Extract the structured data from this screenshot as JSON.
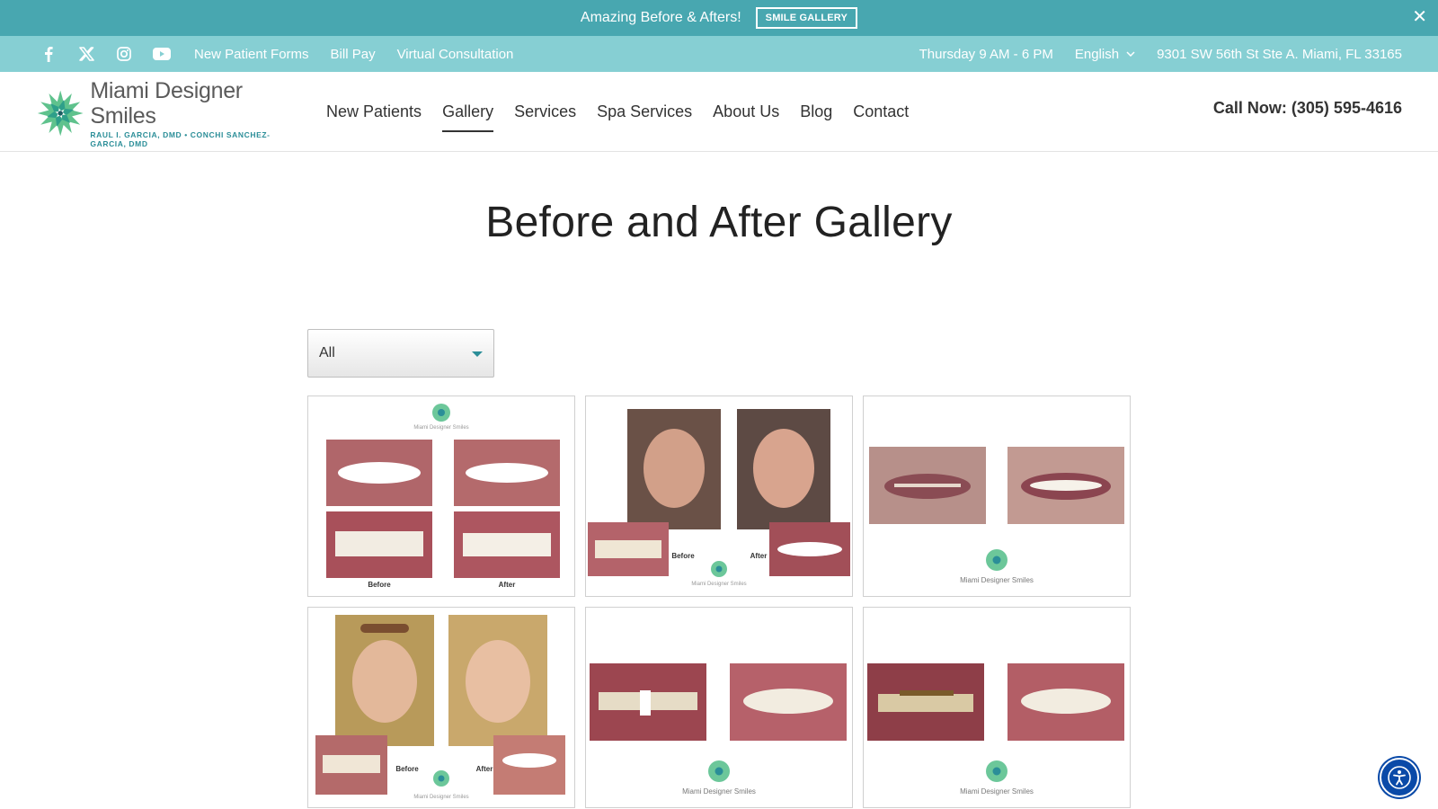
{
  "announcement": {
    "text": "Amazing Before & Afters!",
    "button_label": "SMILE GALLERY",
    "close_glyph": "✕"
  },
  "utility_bar": {
    "social_icons": [
      "facebook-icon",
      "x-icon",
      "instagram-icon",
      "youtube-icon"
    ],
    "links": [
      "New Patient Forms",
      "Bill Pay",
      "Virtual Consultation"
    ],
    "hours": "Thursday 9 AM - 6 PM",
    "language": "English",
    "address": "9301 SW 56th St Ste A. Miami, FL 33165"
  },
  "header": {
    "logo_name": "Miami Designer Smiles",
    "logo_subtitle": "RAUL I. GARCIA, DMD • CONCHI SANCHEZ-GARCIA, DMD",
    "nav": [
      "New Patients",
      "Gallery",
      "Services",
      "Spa Services",
      "About Us",
      "Blog",
      "Contact"
    ],
    "active_nav": "Gallery",
    "call": "Call Now: (305) 595-4616"
  },
  "main": {
    "title": "Before and After Gallery",
    "filter_value": "All",
    "gallery_labels": {
      "before": "Before",
      "after": "After",
      "brand": "Miami Designer Smiles"
    }
  },
  "colors": {
    "announce_bg": "#48a7b0",
    "utility_bg": "#86cfd3",
    "brand_teal": "#2b8e98",
    "logo_green": "#5fc28d",
    "a11y_blue": "#0a4aa8"
  }
}
